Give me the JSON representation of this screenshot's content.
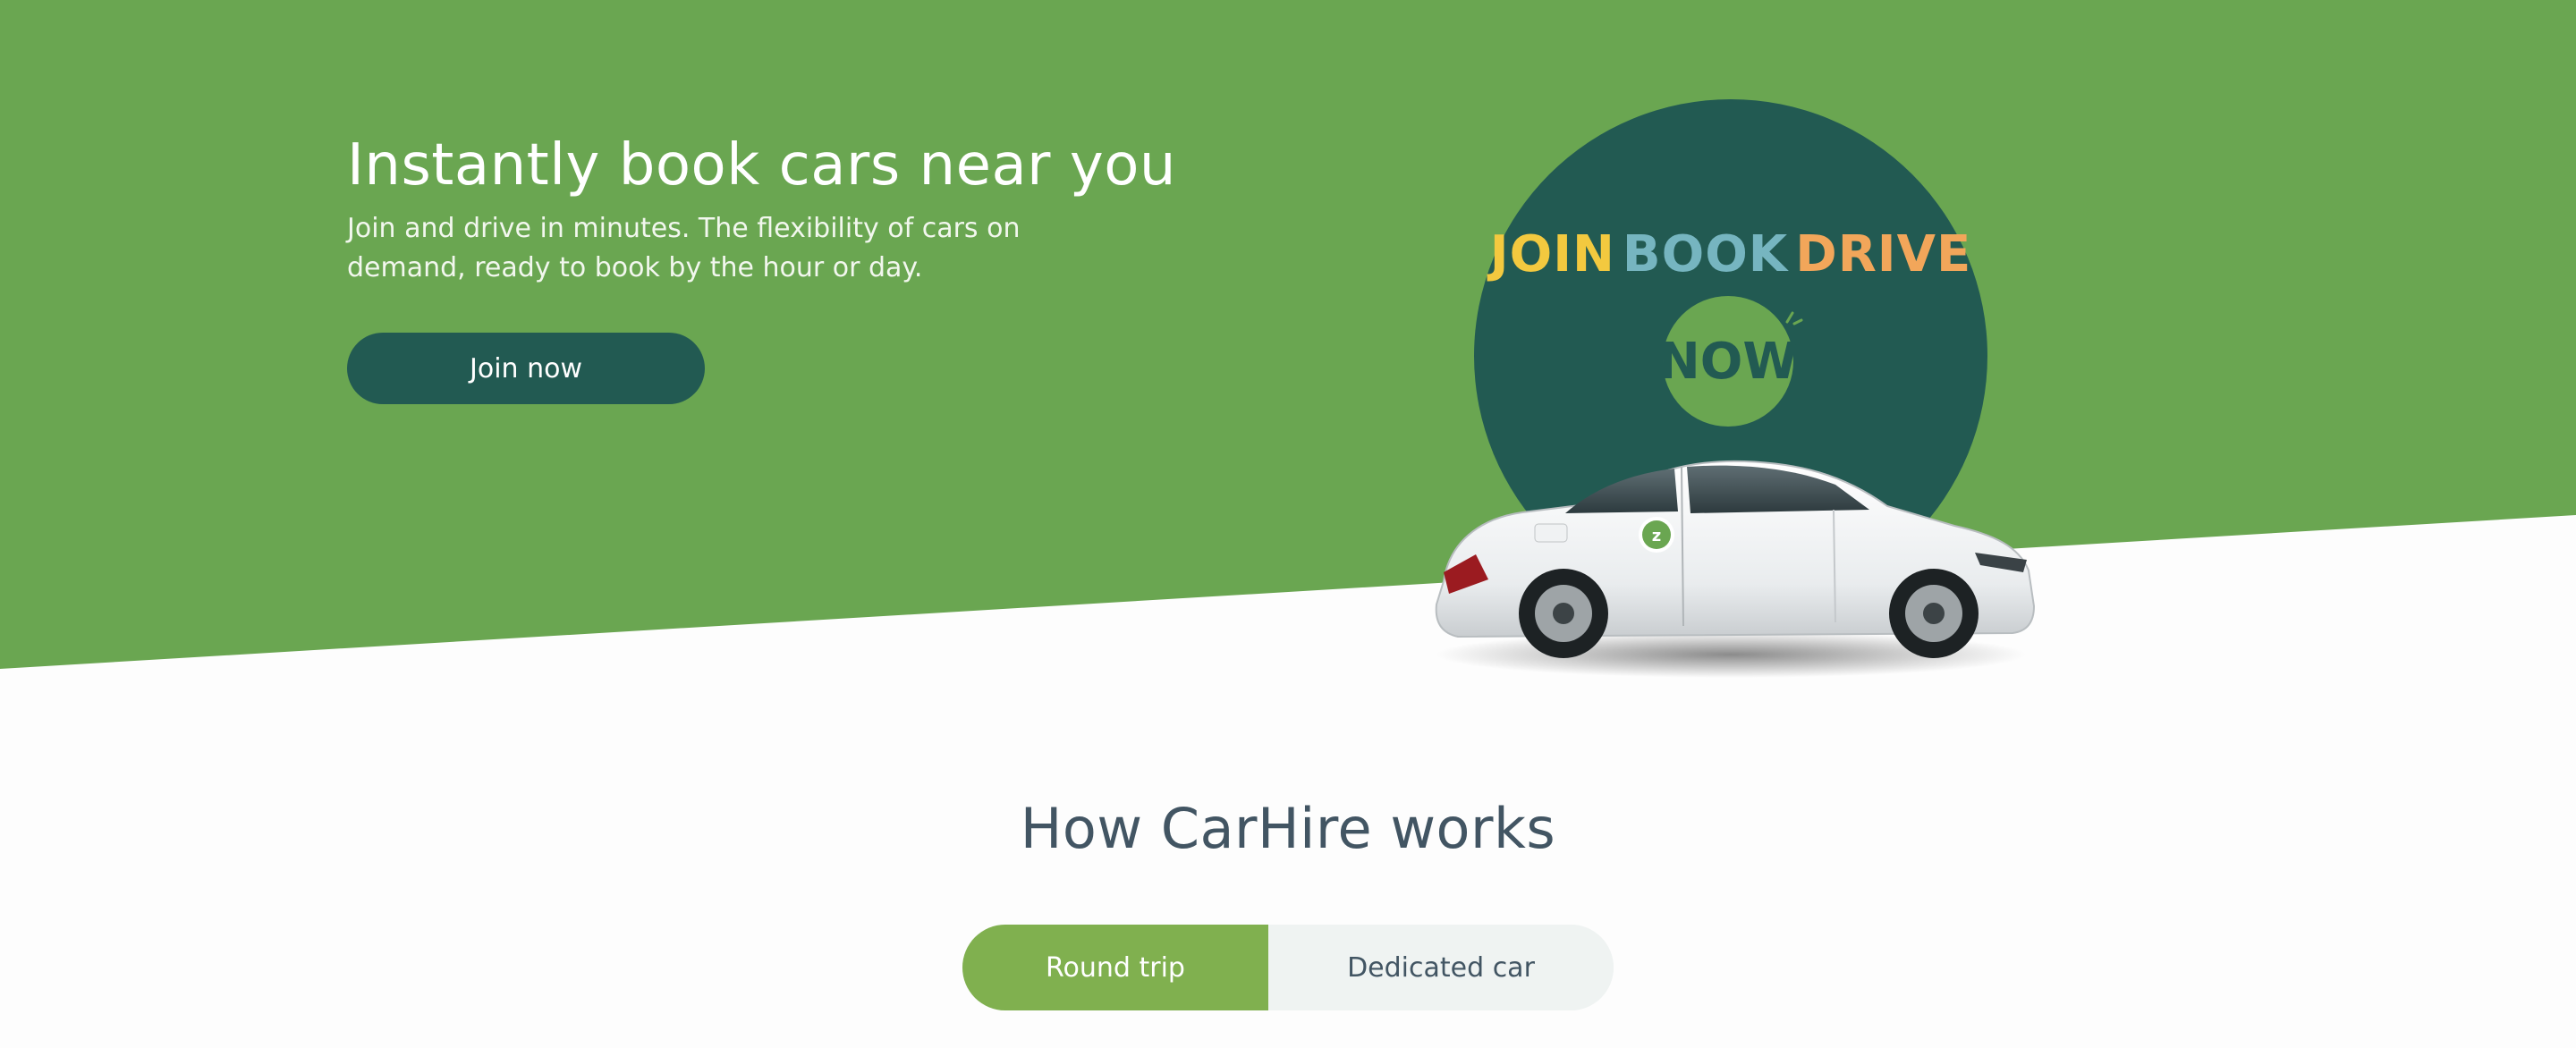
{
  "hero": {
    "title": "Instantly book cars near you",
    "subtitle": "Join and drive in minutes. The flexibility of cars on demand, ready to book by the hour or day.",
    "join_label": "Join now"
  },
  "promo": {
    "word_join": "JOIN",
    "word_book": "BOOK",
    "word_drive": "DRIVE",
    "badge": "NOW",
    "car_icon": "car-image"
  },
  "how_it_works": {
    "title": "How CarHire works",
    "tabs": [
      {
        "label": "Round trip",
        "active": true
      },
      {
        "label": "Dedicated car",
        "active": false
      }
    ]
  },
  "colors": {
    "hero_green": "#6aa651",
    "dark_teal": "#225a52",
    "toggle_green": "#80b04f",
    "heading_slate": "#425563"
  }
}
